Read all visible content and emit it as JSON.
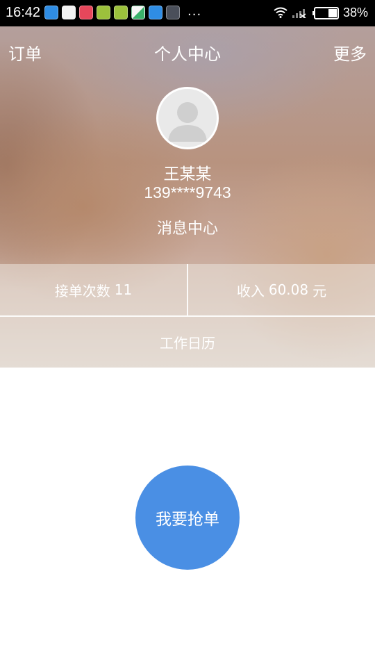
{
  "status_bar": {
    "time": "16:42",
    "notification_icons": [
      "app-store-icon",
      "youku-icon",
      "weibo-icon",
      "book-icon",
      "book-icon",
      "photo-app-icon",
      "app-store-icon",
      "gallery-icon"
    ],
    "overflow": "...",
    "battery": "38%"
  },
  "nav": {
    "left": "订单",
    "title": "个人中心",
    "right": "更多"
  },
  "profile": {
    "name": "王某某",
    "phone": "139****9743",
    "message_center": "消息中心"
  },
  "stats": {
    "orders_label": "接单次数",
    "orders_value": "11",
    "income_label": "收入",
    "income_value": "60.08",
    "income_unit": "元",
    "calendar": "工作日历"
  },
  "action": {
    "grab_order": "我要抢单"
  },
  "colors": {
    "accent": "#4a8fe4",
    "statusbar": "#000000"
  }
}
